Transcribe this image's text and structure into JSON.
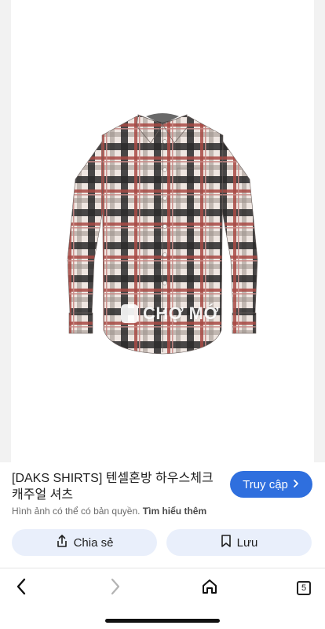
{
  "image": {
    "watermark_text": "CHỢ MỚ",
    "shirt_colors": {
      "base": "#efe6e1",
      "black": "#2a2a2a",
      "red": "#a84a44",
      "gray": "#9a8f8a"
    }
  },
  "result": {
    "title": "[DAKS SHIRTS] 텐셀혼방 하우스체크 캐주얼 셔츠",
    "visit_label": "Truy cập",
    "copyright_notice": "Hình ảnh có thể có bản quyền.",
    "learn_more": "Tìm hiểu thêm"
  },
  "actions": {
    "share_label": "Chia sẻ",
    "save_label": "Lưu"
  },
  "toolbar": {
    "tab_count": "5"
  },
  "colors": {
    "accent": "#2f6fde",
    "action_bg": "#e9effb"
  }
}
